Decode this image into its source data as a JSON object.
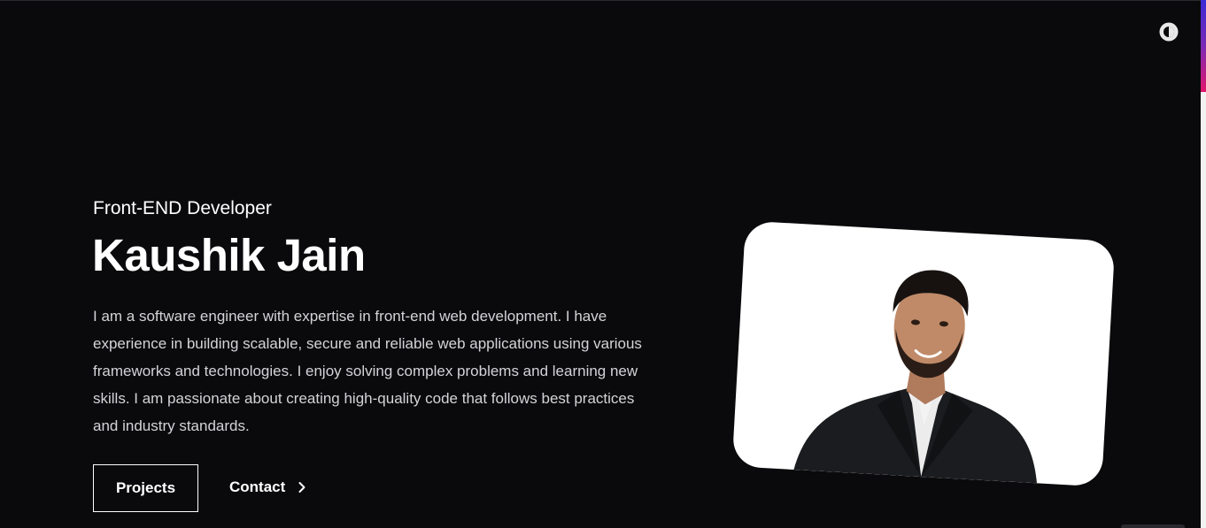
{
  "header": {
    "theme_toggle_icon": "contrast-icon"
  },
  "hero": {
    "role": "Front-END Developer",
    "name": "Kaushik Jain",
    "bio": "I am a software engineer with expertise in front-end web development. I have experience in building scalable, secure and reliable web applications using various frameworks and technologies. I enjoy solving complex problems and learning new skills. I am passionate about creating high-quality code that follows best practices and industry standards."
  },
  "actions": {
    "projects_label": "Projects",
    "contact_label": "Contact",
    "contact_icon": "chevron-right-icon"
  },
  "portrait": {
    "icon": "profile-photo"
  },
  "colors": {
    "background": "#0a0a0c",
    "text": "#ffffff",
    "muted_text": "#d4d4d8",
    "card": "#ffffff",
    "scroll_accent_start": "#3a2bd6",
    "scroll_accent_end": "#e1156b"
  }
}
